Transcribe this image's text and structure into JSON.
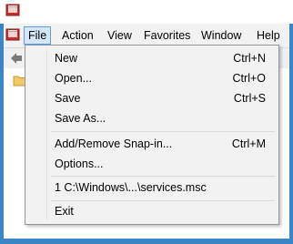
{
  "menubar": {
    "items": [
      {
        "label": "File",
        "active": true
      },
      {
        "label": "Action"
      },
      {
        "label": "View"
      },
      {
        "label": "Favorites"
      },
      {
        "label": "Window"
      },
      {
        "label": "Help"
      }
    ]
  },
  "file_menu": {
    "items": [
      {
        "label": "New",
        "shortcut": "Ctrl+N"
      },
      {
        "label": "Open...",
        "shortcut": "Ctrl+O"
      },
      {
        "label": "Save",
        "shortcut": "Ctrl+S"
      },
      {
        "label": "Save As...",
        "shortcut": ""
      },
      {
        "label": "Add/Remove Snap-in...",
        "shortcut": "Ctrl+M"
      },
      {
        "label": "Options...",
        "shortcut": ""
      },
      {
        "label": "1 C:\\Windows\\...\\services.msc",
        "shortcut": ""
      },
      {
        "label": "Exit",
        "shortcut": ""
      }
    ]
  },
  "colors": {
    "frame_border": "#3a87c8",
    "menu_highlight": "#d5e7f8",
    "menu_highlight_border": "#5a9fe0"
  }
}
